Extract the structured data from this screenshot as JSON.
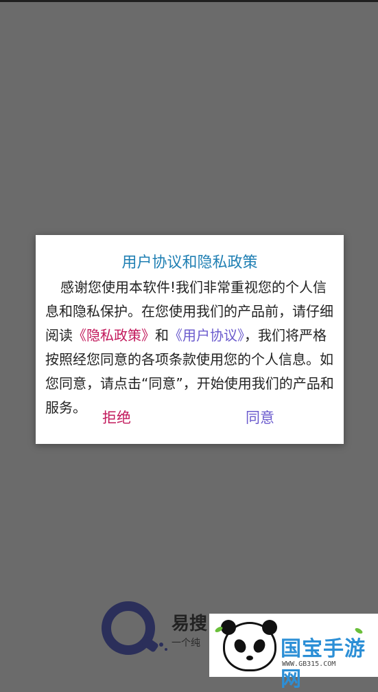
{
  "dialog": {
    "title": "用户协议和隐私政策",
    "body_part1": "感谢您使用本软件!我们非常重视您的个人信息和隐私保护。在您使用我们的产品前，请仔细阅读",
    "privacy_link": "《隐私政策》",
    "and": "和",
    "user_link": "《用户协议》",
    "body_part2": "，我们将严格按照经您同意的各项条款使用您的个人信息。如您同意，请点击“同意”，开始使用我们的产品和服务。",
    "reject_label": "拒绝",
    "agree_label": "同意"
  },
  "brand": {
    "name": "易搜",
    "slogan": "一个纯"
  },
  "watermark": {
    "text": "国宝手游网",
    "url": "WWW.GB315.COM"
  },
  "colors": {
    "title": "#1f7fb3",
    "privacy_link": "#c2185b",
    "user_link": "#6a5acd",
    "overlay": "#6b6b6b"
  }
}
